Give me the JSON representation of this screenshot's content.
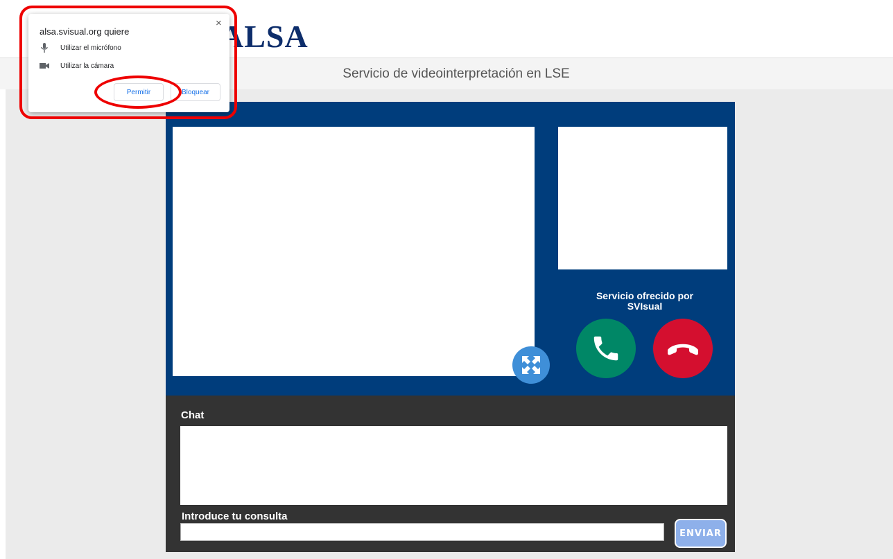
{
  "header": {
    "logo_text": "ALSA",
    "service_title": "Servicio de videointerpretación en LSE"
  },
  "video": {
    "service_line1": "Servicio ofrecido por",
    "service_line2": "SVIsual",
    "icons": [
      "expand-icon",
      "phone-icon",
      "hang-up-icon"
    ]
  },
  "chat": {
    "label": "Chat",
    "query_label": "Introduce tu consulta",
    "send_label": "ENVIAR"
  },
  "permission_popup": {
    "title": "alsa.svisual.org quiere",
    "close_glyph": "×",
    "permissions": [
      "Utilizar el micrófono",
      "Utilizar la cámara"
    ],
    "allow_label": "Permitir",
    "block_label": "Bloquear"
  },
  "colors": {
    "brand_blue": "#003d7c",
    "call_green": "#008766",
    "hang_red": "#d40f2f",
    "chat_bg": "#333333",
    "annotation_red": "#ee0000"
  }
}
